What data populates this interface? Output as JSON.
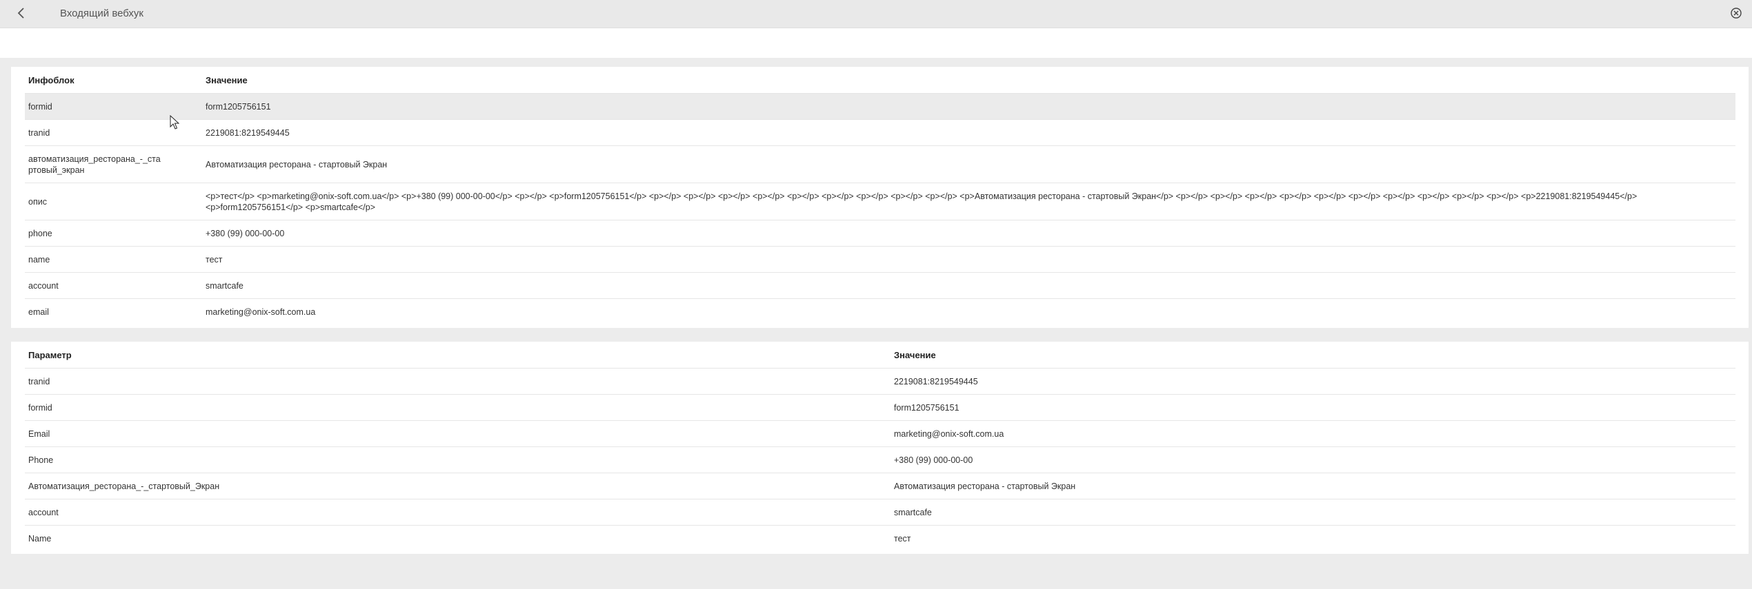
{
  "header": {
    "title": "Входящий вебхук"
  },
  "table1": {
    "col1": "Инфоблок",
    "col2": "Значение",
    "rows": [
      {
        "key": "formid",
        "value": "form1205756151"
      },
      {
        "key": "tranid",
        "value": "2219081:8219549445"
      },
      {
        "key": "автоматизация_ресторана_-_стартовый_экран",
        "value": "Автоматизация ресторана - стартовый Экран"
      },
      {
        "key": "опис",
        "value": "<p>тест</p> <p>marketing@onix-soft.com.ua</p> <p>+380 (99) 000-00-00</p> <p></p> <p>form1205756151</p> <p></p> <p></p> <p></p> <p></p> <p></p> <p></p> <p></p> <p></p> <p></p> <p>Автоматизация ресторана - стартовый Экран</p> <p></p> <p></p> <p></p> <p></p> <p></p> <p></p> <p></p> <p></p> <p></p> <p></p> <p>2219081:8219549445</p> <p>form1205756151</p> <p>smartcafe</p>"
      },
      {
        "key": "phone",
        "value": "+380 (99) 000-00-00"
      },
      {
        "key": "name",
        "value": "тест"
      },
      {
        "key": "account",
        "value": "smartcafe"
      },
      {
        "key": "email",
        "value": "marketing@onix-soft.com.ua"
      }
    ]
  },
  "table2": {
    "col1": "Параметр",
    "col2": "Значение",
    "rows": [
      {
        "key": "tranid",
        "value": "2219081:8219549445"
      },
      {
        "key": "formid",
        "value": "form1205756151"
      },
      {
        "key": "Email",
        "value": "marketing@onix-soft.com.ua"
      },
      {
        "key": "Phone",
        "value": "+380 (99) 000-00-00"
      },
      {
        "key": "Автоматизация_ресторана_-_стартовый_Экран",
        "value": "Автоматизация ресторана - стартовый Экран"
      },
      {
        "key": "account",
        "value": "smartcafe"
      },
      {
        "key": "Name",
        "value": "тест"
      }
    ]
  },
  "icons": {
    "back": "chevron-left-icon",
    "close": "close-circle-icon"
  }
}
